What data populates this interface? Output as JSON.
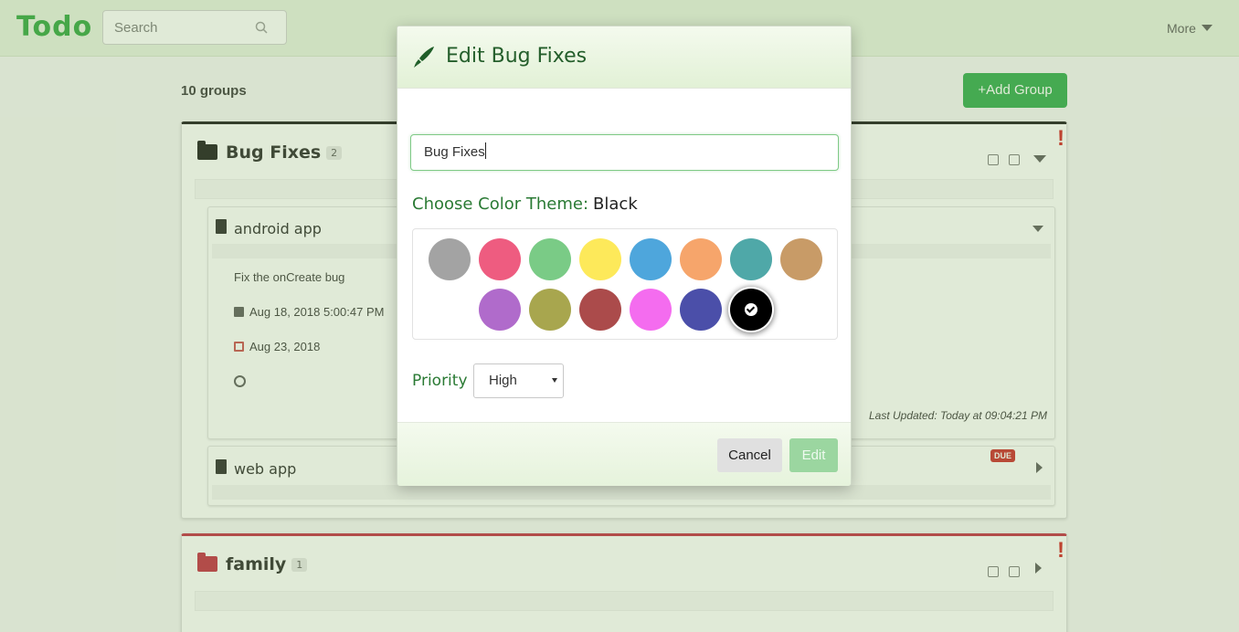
{
  "navbar": {
    "logo": "Todo",
    "search_placeholder": "Search",
    "more_label": "More"
  },
  "page": {
    "group_count": "10 groups",
    "add_group_label": "Add Group"
  },
  "groups": [
    {
      "title": "Bug Fixes",
      "count": "2",
      "color": "#111111",
      "priority_mark": "!",
      "cards": [
        {
          "title": "android app",
          "description": "Fix the onCreate bug",
          "created": "Aug 18, 2018 5:00:47 PM",
          "due": "Aug 23, 2018",
          "last_updated": "Last Updated: Today at 09:04:21 PM"
        },
        {
          "title": "web app",
          "badge": "DUE"
        }
      ]
    },
    {
      "title": "family",
      "count": "1",
      "color": "#c0243b",
      "priority_mark": "!"
    }
  ],
  "modal": {
    "title": "Edit Bug Fixes",
    "name_value": "Bug Fixes",
    "theme_label": "Choose Color Theme:",
    "theme_value": "Black",
    "priority_label": "Priority",
    "priority_value": "High",
    "cancel_label": "Cancel",
    "edit_label": "Edit",
    "swatches": [
      [
        "#a3a3a3",
        "#ee5c80",
        "#7acb86",
        "#fde95a",
        "#4ea6dc",
        "#f6a56b",
        "#4fa8a8",
        "#c89b67"
      ],
      [
        "#b06bcb",
        "#a8a64e",
        "#ab4b4b",
        "#f46cef",
        "#4b4fa9",
        "#000000"
      ]
    ],
    "selected_swatch": "#000000"
  }
}
